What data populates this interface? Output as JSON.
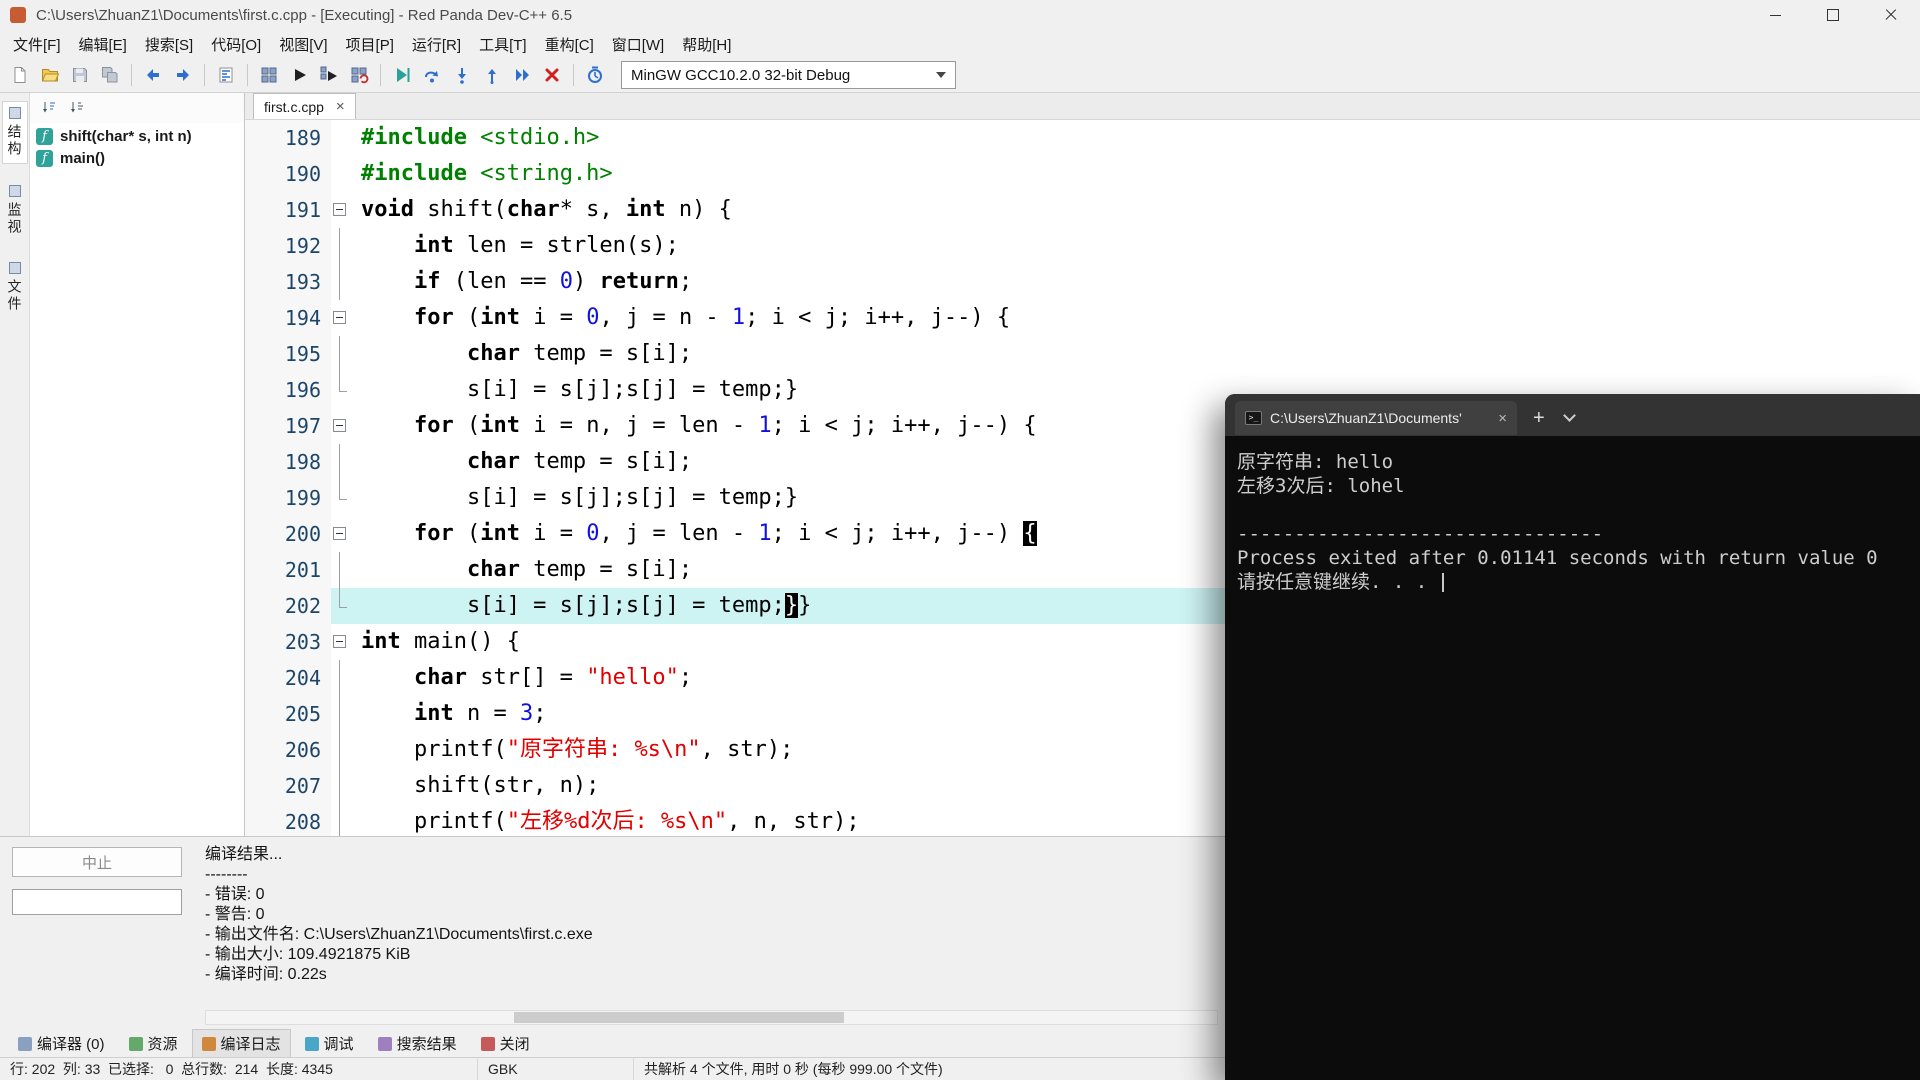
{
  "window": {
    "title": "C:\\Users\\ZhuanZ1\\Documents\\first.c.cpp - [Executing] - Red Panda Dev-C++ 6.5"
  },
  "menu": {
    "items": [
      {
        "name": "menu-file",
        "label": "文件[F]"
      },
      {
        "name": "menu-edit",
        "label": "编辑[E]"
      },
      {
        "name": "menu-search",
        "label": "搜索[S]"
      },
      {
        "name": "menu-code",
        "label": "代码[O]"
      },
      {
        "name": "menu-view",
        "label": "视图[V]"
      },
      {
        "name": "menu-project",
        "label": "项目[P]"
      },
      {
        "name": "menu-run",
        "label": "运行[R]"
      },
      {
        "name": "menu-tools",
        "label": "工具[T]"
      },
      {
        "name": "menu-refactor",
        "label": "重构[C]"
      },
      {
        "name": "menu-window",
        "label": "窗口[W]"
      },
      {
        "name": "menu-help",
        "label": "帮助[H]"
      }
    ]
  },
  "toolbar": {
    "compiler_set": "MinGW GCC10.2.0 32-bit Debug"
  },
  "side_tabs": {
    "items": [
      {
        "name": "side-tab-structure",
        "icon": "structure-icon",
        "label": "结构",
        "active": true
      },
      {
        "name": "side-tab-watch",
        "icon": "watch-icon",
        "label": "监视",
        "active": false
      },
      {
        "name": "side-tab-files",
        "icon": "files-icon",
        "label": "文件",
        "active": false
      }
    ]
  },
  "class_browser": {
    "items": [
      {
        "badge": "f",
        "label": "shift(char* s, int n)"
      },
      {
        "badge": "f",
        "label": "main()"
      }
    ]
  },
  "editor": {
    "tab_label": "first.c.cpp",
    "close_glyph": "×",
    "lines": [
      {
        "num": 189,
        "fold": "",
        "segs": [
          [
            "p",
            "#include"
          ],
          [
            "t",
            " "
          ],
          [
            "h",
            "<stdio.h>"
          ]
        ]
      },
      {
        "num": 190,
        "fold": "",
        "segs": [
          [
            "p",
            "#include"
          ],
          [
            "t",
            " "
          ],
          [
            "h",
            "<string.h>"
          ]
        ]
      },
      {
        "num": 191,
        "fold": "open",
        "segs": [
          [
            "k",
            "void"
          ],
          [
            "t",
            " shift("
          ],
          [
            "k",
            "char"
          ],
          [
            "t",
            "* s, "
          ],
          [
            "k",
            "int"
          ],
          [
            "t",
            " n) {"
          ]
        ]
      },
      {
        "num": 192,
        "fold": "line",
        "segs": [
          [
            "t",
            "    "
          ],
          [
            "k",
            "int"
          ],
          [
            "t",
            " len = strlen(s);"
          ]
        ]
      },
      {
        "num": 193,
        "fold": "line",
        "segs": [
          [
            "t",
            "    "
          ],
          [
            "k",
            "if"
          ],
          [
            "t",
            " (len == "
          ],
          [
            "n",
            "0"
          ],
          [
            "t",
            ") "
          ],
          [
            "k",
            "return"
          ],
          [
            "t",
            ";"
          ]
        ]
      },
      {
        "num": 194,
        "fold": "open",
        "segs": [
          [
            "t",
            "    "
          ],
          [
            "k",
            "for"
          ],
          [
            "t",
            " ("
          ],
          [
            "k",
            "int"
          ],
          [
            "t",
            " i = "
          ],
          [
            "n",
            "0"
          ],
          [
            "t",
            ", j = n - "
          ],
          [
            "n",
            "1"
          ],
          [
            "t",
            "; i < j; i++, j--) {"
          ]
        ]
      },
      {
        "num": 195,
        "fold": "line",
        "segs": [
          [
            "t",
            "        "
          ],
          [
            "k",
            "char"
          ],
          [
            "t",
            " temp = s[i];"
          ]
        ]
      },
      {
        "num": 196,
        "fold": "end",
        "segs": [
          [
            "t",
            "        s[i] = s[j];s[j] = temp;}"
          ]
        ]
      },
      {
        "num": 197,
        "fold": "open",
        "segs": [
          [
            "t",
            "    "
          ],
          [
            "k",
            "for"
          ],
          [
            "t",
            " ("
          ],
          [
            "k",
            "int"
          ],
          [
            "t",
            " i = n, j = len - "
          ],
          [
            "n",
            "1"
          ],
          [
            "t",
            "; i < j; i++, j--) {"
          ]
        ]
      },
      {
        "num": 198,
        "fold": "line",
        "segs": [
          [
            "t",
            "        "
          ],
          [
            "k",
            "char"
          ],
          [
            "t",
            " temp = s[i];"
          ]
        ]
      },
      {
        "num": 199,
        "fold": "end",
        "segs": [
          [
            "t",
            "        s[i] = s[j];s[j] = temp;}"
          ]
        ]
      },
      {
        "num": 200,
        "fold": "open",
        "segs": [
          [
            "t",
            "    "
          ],
          [
            "k",
            "for"
          ],
          [
            "t",
            " ("
          ],
          [
            "k",
            "int"
          ],
          [
            "t",
            " i = "
          ],
          [
            "n",
            "0"
          ],
          [
            "t",
            ", j = len - "
          ],
          [
            "n",
            "1"
          ],
          [
            "t",
            "; i < j; i++, j--) "
          ],
          [
            "m",
            "{"
          ]
        ]
      },
      {
        "num": 201,
        "fold": "line",
        "segs": [
          [
            "t",
            "        "
          ],
          [
            "k",
            "char"
          ],
          [
            "t",
            " temp = s[i];"
          ]
        ]
      },
      {
        "num": 202,
        "fold": "end",
        "hl": true,
        "segs": [
          [
            "t",
            "        s[i] = s[j];s[j] = temp;"
          ],
          [
            "c",
            "}"
          ],
          [
            "t",
            "}"
          ]
        ]
      },
      {
        "num": 203,
        "fold": "open",
        "segs": [
          [
            "k",
            "int"
          ],
          [
            "t",
            " main() {"
          ]
        ]
      },
      {
        "num": 204,
        "fold": "line",
        "segs": [
          [
            "t",
            "    "
          ],
          [
            "k",
            "char"
          ],
          [
            "t",
            " str[] = "
          ],
          [
            "s",
            "\"hello\""
          ],
          [
            "t",
            ";"
          ]
        ]
      },
      {
        "num": 205,
        "fold": "line",
        "segs": [
          [
            "t",
            "    "
          ],
          [
            "k",
            "int"
          ],
          [
            "t",
            " n = "
          ],
          [
            "n",
            "3"
          ],
          [
            "t",
            ";"
          ]
        ]
      },
      {
        "num": 206,
        "fold": "line",
        "segs": [
          [
            "t",
            "    printf("
          ],
          [
            "s",
            "\"原字符串: %s\\n\""
          ],
          [
            "t",
            ", str);"
          ]
        ]
      },
      {
        "num": 207,
        "fold": "line",
        "segs": [
          [
            "t",
            "    shift(str, n);"
          ]
        ]
      },
      {
        "num": 208,
        "fold": "line",
        "segs": [
          [
            "t",
            "    printf("
          ],
          [
            "s",
            "\"左移%d次后: %s\\n\""
          ],
          [
            "t",
            ", n, str);"
          ]
        ]
      }
    ]
  },
  "bottom_panel": {
    "abort_label": "中止"
  },
  "compile_log": {
    "lines": [
      "编译结果...",
      "--------",
      "- 错误: 0",
      "- 警告: 0",
      "- 输出文件名: C:\\Users\\ZhuanZ1\\Documents\\first.c.exe",
      "- 输出大小: 109.4921875 KiB",
      "- 编译时间: 0.22s"
    ]
  },
  "bottom_tabs": {
    "items": [
      {
        "name": "tab-compiler",
        "icon": "compiler-icon",
        "label": "编译器 (0)",
        "active": false
      },
      {
        "name": "tab-resources",
        "icon": "resources-icon",
        "label": "资源",
        "active": false
      },
      {
        "name": "tab-compile-log",
        "icon": "compile-log-icon",
        "label": "编译日志",
        "active": true
      },
      {
        "name": "tab-debug",
        "icon": "debugger-icon",
        "label": "调试",
        "active": false
      },
      {
        "name": "tab-search-results",
        "icon": "search-results-icon",
        "label": "搜索结果",
        "active": false
      },
      {
        "name": "tab-close-panel",
        "icon": "close-panel-icon",
        "label": "关闭",
        "active": false
      }
    ]
  },
  "statusbar": {
    "segments": [
      "行: 202  列: 33  已选择:   0  总行数:  214  长度: 4345",
      "GBK",
      "共解析 4 个文件, 用时 0 秒 (每秒 999.00 个文件)"
    ]
  },
  "terminal": {
    "tab_title": "C:\\Users\\ZhuanZ1\\Documents'",
    "cmd_glyph": ">_",
    "close_glyph": "×",
    "new_tab_glyph": "+",
    "lines": [
      "原字符串: hello",
      "左移3次后: lohel",
      "",
      "--------------------------------",
      "Process exited after 0.01141 seconds with return value 0",
      "请按任意键继续. . . "
    ]
  },
  "colors": {
    "preprocessor": "#008000",
    "number": "#1010e0",
    "string": "#e00000",
    "line_highlight": "#cdf3f3",
    "terminal_bg": "#0c0c0c",
    "function_badge": "#2fa39a"
  }
}
